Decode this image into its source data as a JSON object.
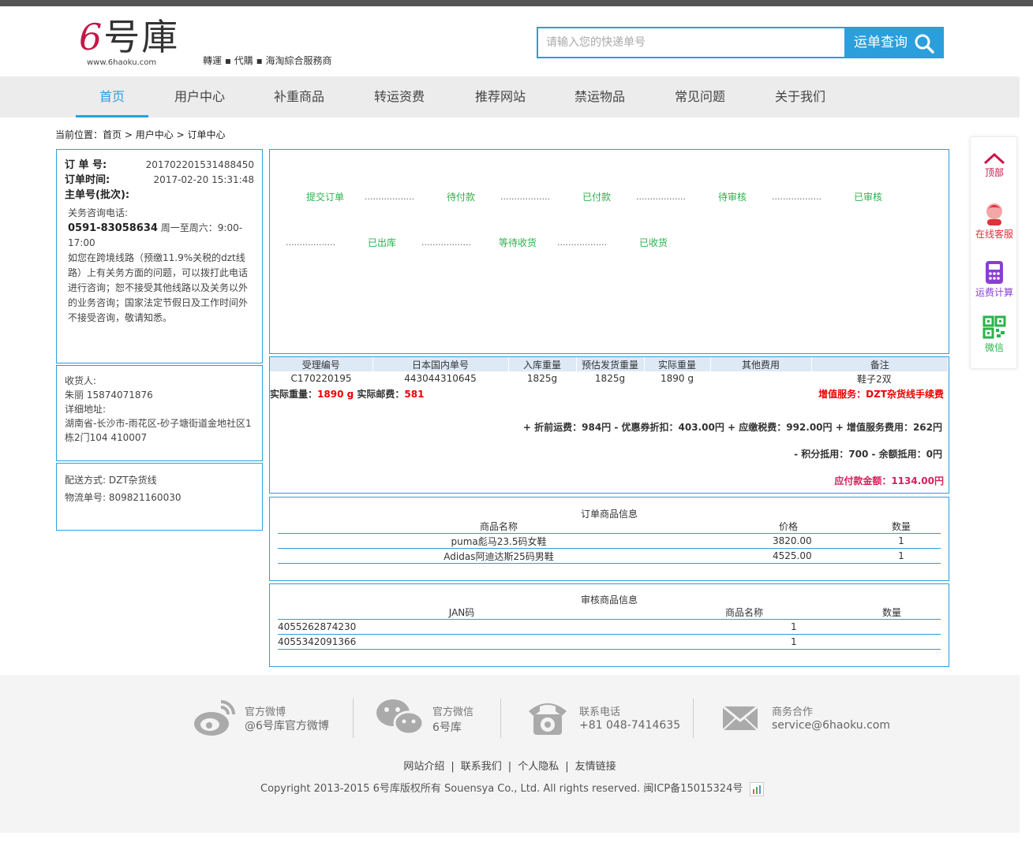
{
  "header": {
    "logo_text": "6号庫",
    "logo_url": "www.6haoku.com",
    "slogan": "轉運 ▪ 代購 ▪ 海淘綜合服務商",
    "search_placeholder": "请输入您的快递单号",
    "search_button": "运单查询"
  },
  "nav": {
    "items": [
      "首页",
      "用户中心",
      "补重商品",
      "转运资费",
      "推荐网站",
      "禁运物品",
      "常见问题",
      "关于我们"
    ],
    "active": "首页"
  },
  "breadcrumb": {
    "prefix": "当前位置：",
    "items": [
      "首页",
      "用户中心",
      "订单中心"
    ]
  },
  "order": {
    "no_label": "订 单 号:",
    "no_value": "201702201531488450",
    "time_label": "订单时间:",
    "time_value": "2017-02-20 15:31:48",
    "master_label": "主单号(批次):",
    "consult_title": "关务咨询电话:",
    "consult_phone": "0591-83058634",
    "consult_hours": "周一至周六：9:00-17:00",
    "consult_text": "如您在跨境线路（预缴11.9%关税的dzt线路）上有关务方面的问题，可以拨打此电话进行咨询；恕不接受其他线路以及关务以外的业务咨询；国家法定节假日及工作时间外不接受咨询，敬请知悉。"
  },
  "receiver": {
    "label": "收货人:",
    "name_phone": "朱丽 15874071876",
    "addr_label": "详细地址:",
    "address": "湖南省-长沙市-雨花区-砂子塘街道金地社区1栋2门104 410007"
  },
  "shipping": {
    "method": "配送方式: DZT杂货线",
    "tracking": "物流单号: 809821160030"
  },
  "status": {
    "steps": [
      "提交订单",
      "待付款",
      "已付款",
      "待审核",
      "已审核",
      "已出库",
      "等待收货",
      "已收货"
    ],
    "dots": "..................",
    "colors": {
      "step": "#2bb24c"
    }
  },
  "detail": {
    "headers": [
      "受理编号",
      "日本国内单号",
      "入库重量",
      "预估发货重量",
      "实际重量",
      "其他费用",
      "备注"
    ],
    "row": [
      "C170220195",
      "443044310645",
      "1825g",
      "1825g",
      "1890 g",
      "",
      "鞋子2双"
    ],
    "weight_label": "实际重量：",
    "weight_value": "1890 g",
    "postage_label": "实际邮费：",
    "postage_value": "581",
    "vas": "增值服务：DZT杂货线手续费",
    "fee_line": "+ 折前运费：984円 - 优惠券折扣：403.00円 + 应缴税费：992.00円 + 增值服务费用：262円",
    "deduct_line": "- 积分抵用：700 - 余额抵用：0円",
    "total": "应付款金额：1134.00円"
  },
  "goods": {
    "title": "订单商品信息",
    "headers": [
      "商品名称",
      "价格",
      "数量"
    ],
    "rows": [
      [
        "puma彪马23.5码女鞋",
        "3820.00",
        "1"
      ],
      [
        "Adidas阿迪达斯25码男鞋",
        "4525.00",
        "1"
      ]
    ]
  },
  "review": {
    "title": "审核商品信息",
    "headers": [
      "JAN码",
      "商品名称",
      "数量"
    ],
    "rows": [
      [
        "4055262874230",
        "",
        "1"
      ],
      [
        "4055342091366",
        "",
        "1"
      ]
    ]
  },
  "side": {
    "items": [
      "顶部",
      "在线客服",
      "运费计算",
      "微信"
    ],
    "colors": {
      "top": "#c4174a",
      "service": "#e0303a",
      "calc": "#8a3fd1",
      "wechat": "#2bb24c"
    }
  },
  "footer": {
    "contacts": [
      {
        "title": "官方微博",
        "sub": "@6号库官方微博",
        "icon": "weibo-icon"
      },
      {
        "title": "官方微信",
        "sub": "6号库",
        "icon": "wechat-icon"
      },
      {
        "title": "联系电话",
        "sub": "+81 048-7414635",
        "icon": "phone-icon"
      },
      {
        "title": "商务合作",
        "sub": "service@6haoku.com",
        "icon": "mail-icon"
      }
    ],
    "links": [
      "网站介绍",
      "联系我们",
      "个人隐私",
      "友情链接"
    ],
    "copyright": "Copyright 2013-2015 6号库版权所有 Souensya Co., Ltd. All rights reserved. 闽ICP备15015324号"
  }
}
